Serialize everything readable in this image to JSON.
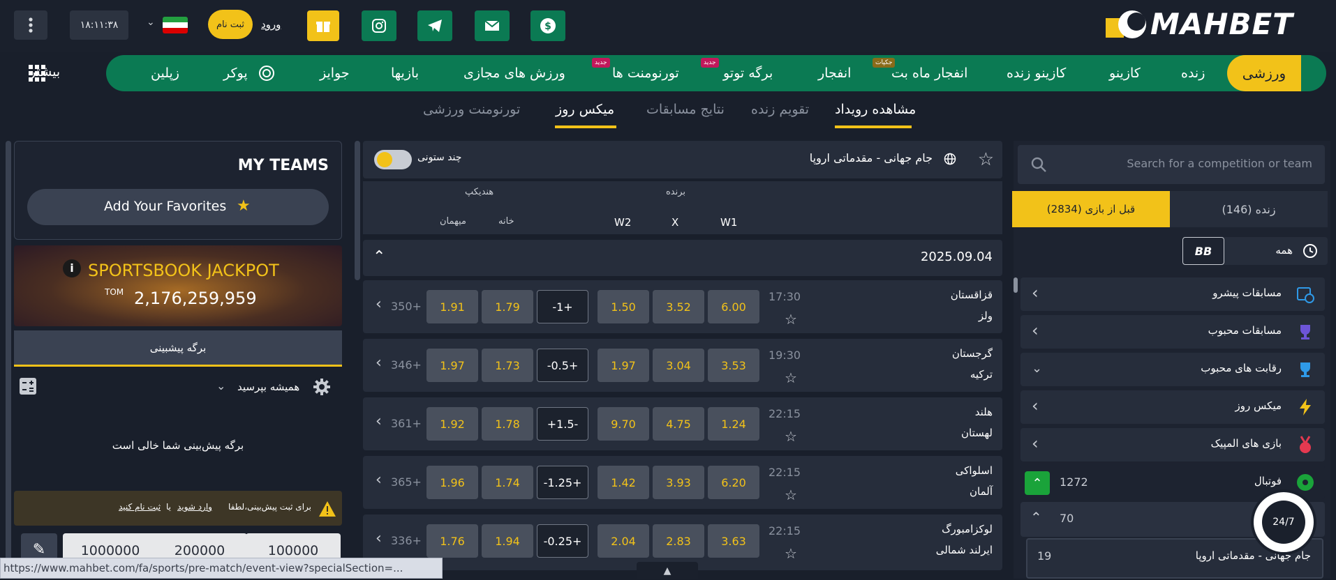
{
  "header": {
    "menu_icon": "kebab-menu-icon",
    "clock": "۱۸:۱۱:۳۸",
    "register_label": "ثبت نام",
    "login_label": "ورود",
    "logo_text": "MAHBET",
    "social_icons": [
      "gift-icon",
      "instagram-icon",
      "telegram-icon",
      "mail-icon",
      "dollar-icon"
    ],
    "colors": {
      "brand_green": "#0b7a53",
      "accent_yellow": "#f2c219"
    }
  },
  "nav": {
    "more_label": "بیشتر",
    "items": [
      "ورزشی",
      "زنده",
      "کازینو",
      "کازینو زنده",
      "انفجار ماه بت",
      "انفجار",
      "برگه توتو",
      "تورنومنت ها",
      "ورزش های مجازی",
      "بازیها",
      "جوایز",
      "پوکر",
      "زپلین"
    ],
    "badges": {
      "jackpot": "جکپات",
      "new1": "جدید",
      "new2": "جدید"
    }
  },
  "subnav": {
    "items": [
      "مشاهده رویداد",
      "تقویم زنده",
      "نتایج مسابقات",
      "میکس روز",
      "تورنومنت ورزشی"
    ]
  },
  "left": {
    "search_placeholder": "Search for a competition or team",
    "tab_live": "زنده (146)",
    "tab_prematch": "قبل از بازی (2834)",
    "filter_all": "همه",
    "bb_label": "BB",
    "rows": [
      "مسابقات پیشرو",
      "مسابقات محبوب",
      "رقابت های محبوب",
      "میکس روز",
      "بازی های المپیک"
    ],
    "football_label": "فوتبال",
    "football_count": "1272",
    "sub_count": "70",
    "comp_label": "جام جهانی - مقدماتی اروپا",
    "comp_count": "19",
    "support_label": "24/7"
  },
  "center": {
    "title": "جام جهانی - مقدماتی اروپا",
    "multi_col": "چند ستونی",
    "winner": "برنده",
    "handicap": "هندیکپ",
    "col_w1": "W1",
    "col_x": "X",
    "col_w2": "W2",
    "col_home": "خانه",
    "col_away": "میهمان",
    "date": "2025.09.04",
    "matches": [
      {
        "team1": "قزاقستان",
        "team2": "ولز",
        "time": "17:30",
        "w1": "6.00",
        "x": "3.52",
        "w2": "1.50",
        "hcap": "-1+",
        "home": "1.79",
        "away": "1.91",
        "more": "350+"
      },
      {
        "team1": "گرجستان",
        "team2": "ترکیه",
        "time": "19:30",
        "w1": "3.53",
        "x": "3.04",
        "w2": "1.97",
        "hcap": "-0.5+",
        "home": "1.73",
        "away": "1.97",
        "more": "346+"
      },
      {
        "team1": "هلند",
        "team2": "لهستان",
        "time": "22:15",
        "w1": "1.24",
        "x": "4.75",
        "w2": "9.70",
        "hcap": "+1.5-",
        "home": "1.78",
        "away": "1.92",
        "more": "361+"
      },
      {
        "team1": "اسلواکی",
        "team2": "آلمان",
        "time": "22:15",
        "w1": "6.20",
        "x": "3.93",
        "w2": "1.42",
        "hcap": "-1.25+",
        "home": "1.74",
        "away": "1.96",
        "more": "365+"
      },
      {
        "team1": "لوکزامبورگ",
        "team2": "ایرلند شمالی",
        "time": "22:15",
        "w1": "3.63",
        "x": "2.83",
        "w2": "2.04",
        "hcap": "-0.25+",
        "home": "1.94",
        "away": "1.76",
        "more": "336+"
      }
    ]
  },
  "right": {
    "my_teams": "MY TEAMS",
    "add_fav": "Add Your Favorites",
    "jackpot_title": "SPORTSBOOK JACKPOT",
    "jackpot_currency": "TOM",
    "jackpot_amount": "2,176,259,959",
    "betslip_tab": "برگه پیشبینی",
    "always_ask": "همیشه بپرسید",
    "empty": "برگه پیش‌بینی شما خالی است",
    "warn_text": "برای ثبت پیش‌بینی،لطفا",
    "warn_login": "وارد شوید",
    "warn_or": "یا",
    "warn_register": "ثبت نام کنید",
    "amounts": [
      "100000",
      "200000",
      "1000000"
    ]
  },
  "status_url": "https://www.mahbet.com/fa/sports/pre-match/event-view?specialSection=..."
}
